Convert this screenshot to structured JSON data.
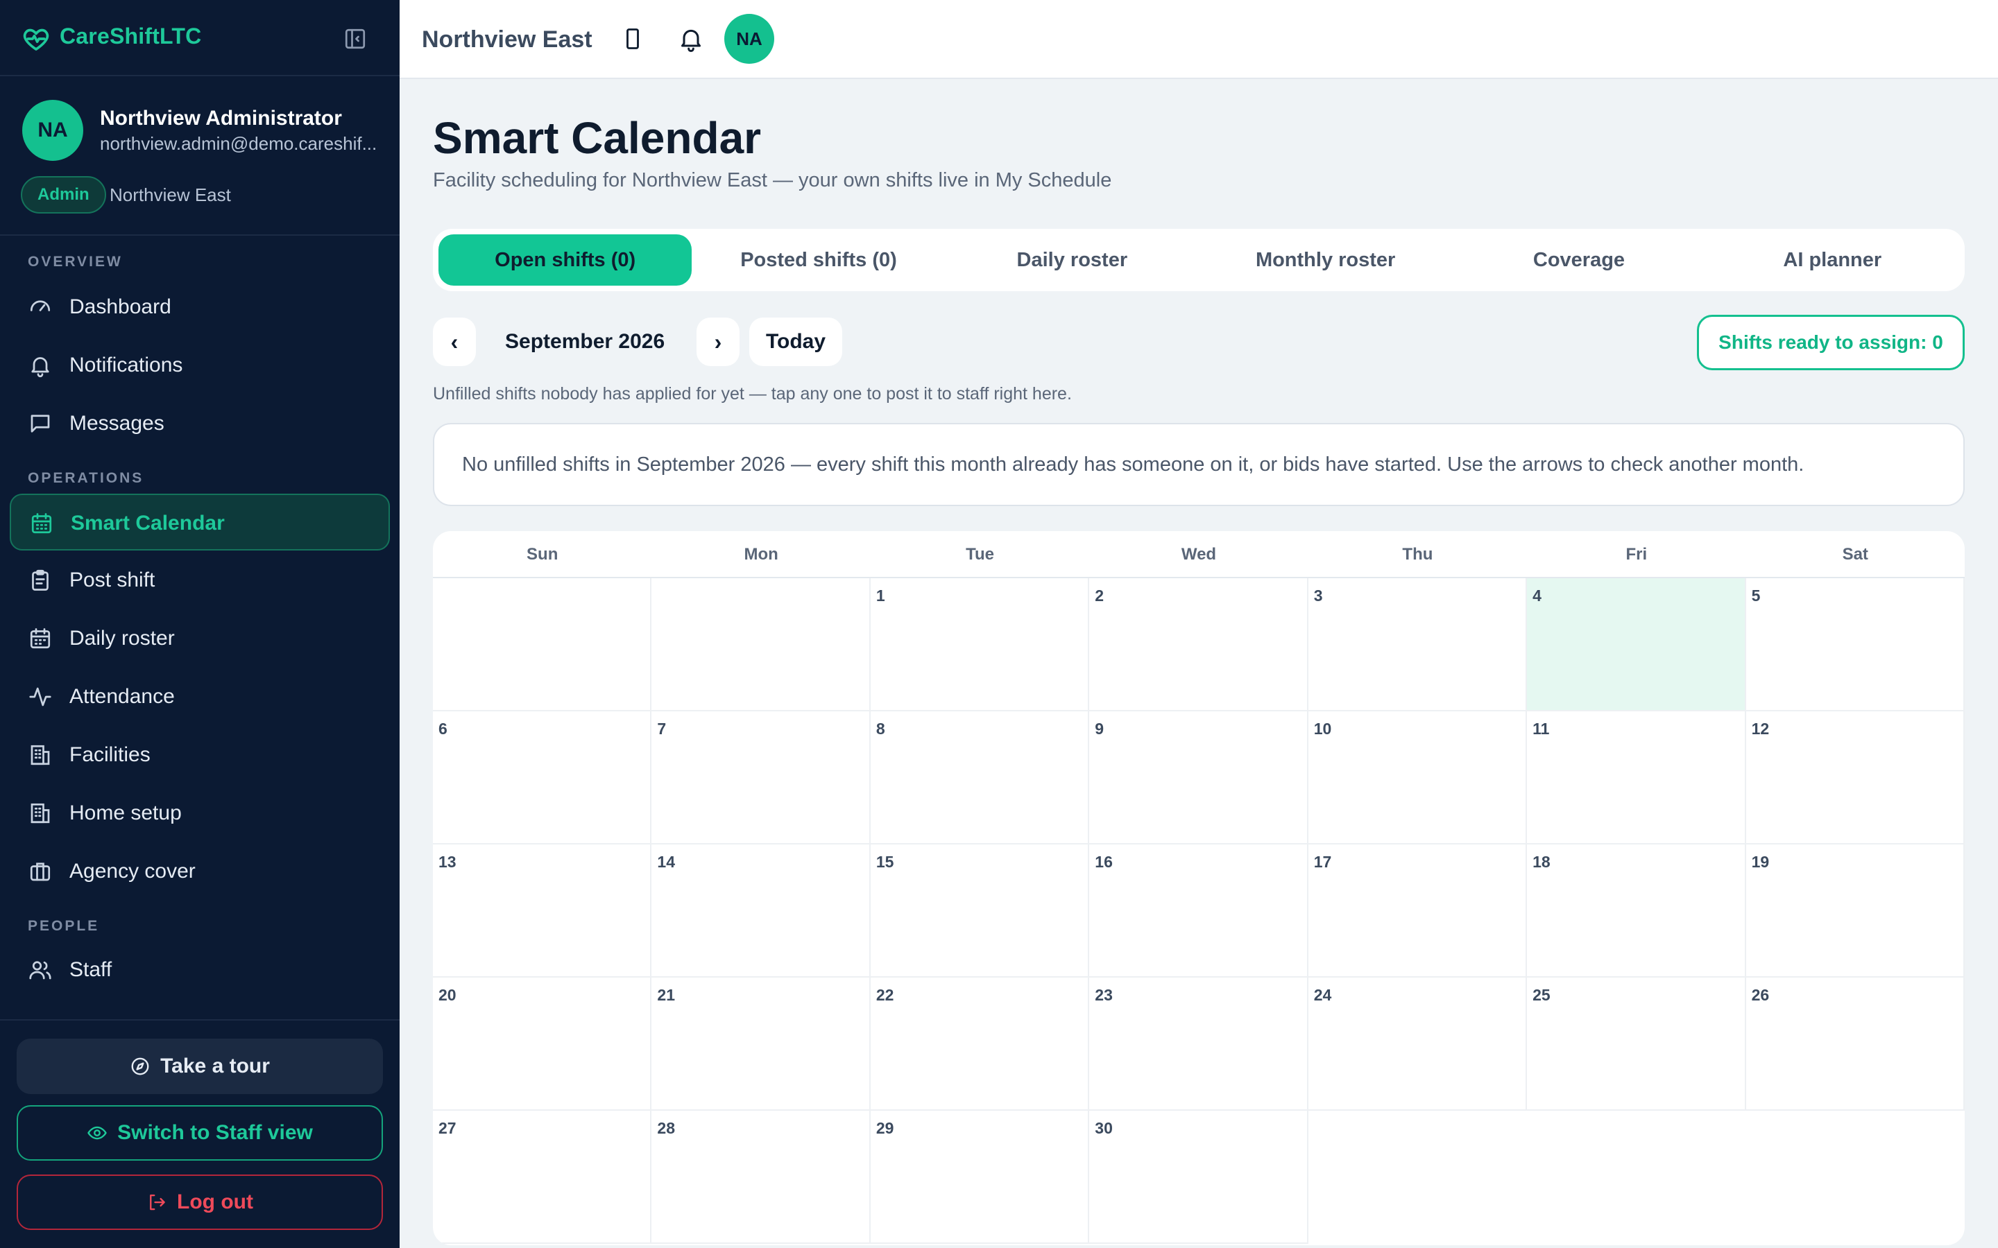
{
  "app": {
    "brand": "CareShiftLTC"
  },
  "user": {
    "initials": "NA",
    "name": "Northview Administrator",
    "email": "northview.admin@demo.careshif...",
    "role": "Admin",
    "facility": "Northview East"
  },
  "nav": {
    "sections": {
      "overview": "OVERVIEW",
      "operations": "OPERATIONS",
      "people": "PEOPLE"
    },
    "items": {
      "dashboard": "Dashboard",
      "notifications": "Notifications",
      "messages": "Messages",
      "smart_calendar": "Smart Calendar",
      "post_shift": "Post shift",
      "daily_roster": "Daily roster",
      "attendance": "Attendance",
      "facilities": "Facilities",
      "home_setup": "Home setup",
      "agency_cover": "Agency cover",
      "staff": "Staff"
    },
    "active": "smart_calendar"
  },
  "footer": {
    "tour": "Take a tour",
    "switch_view": "Switch to Staff view",
    "logout": "Log out"
  },
  "topbar": {
    "facility": "Northview East",
    "avatar_initials": "NA"
  },
  "page": {
    "title": "Smart Calendar",
    "subtitle": "Facility scheduling for Northview East — your own shifts live in My Schedule"
  },
  "tabs": {
    "open": "Open shifts (0)",
    "posted": "Posted shifts (0)",
    "daily": "Daily roster",
    "monthly": "Monthly roster",
    "coverage": "Coverage",
    "ai": "AI planner",
    "active": "open"
  },
  "calendar_nav": {
    "prev": "‹",
    "next": "›",
    "month": "September 2026",
    "today": "Today",
    "ready": "Shifts ready to assign: 0"
  },
  "hint": "Unfilled shifts nobody has applied for yet — tap any one to post it to staff right here.",
  "empty_message": "No unfilled shifts in September 2026 — every shift this month already has someone on it, or bids have started. Use the arrows to check another month.",
  "calendar": {
    "weekdays": [
      "Sun",
      "Mon",
      "Tue",
      "Wed",
      "Thu",
      "Fri",
      "Sat"
    ],
    "first_weekday_index": 2,
    "days_in_month": 30,
    "highlighted_day": 4
  },
  "colors": {
    "accent": "#14c08f",
    "sidebar_bg": "#0b1a33",
    "danger": "#ef4a5a"
  }
}
